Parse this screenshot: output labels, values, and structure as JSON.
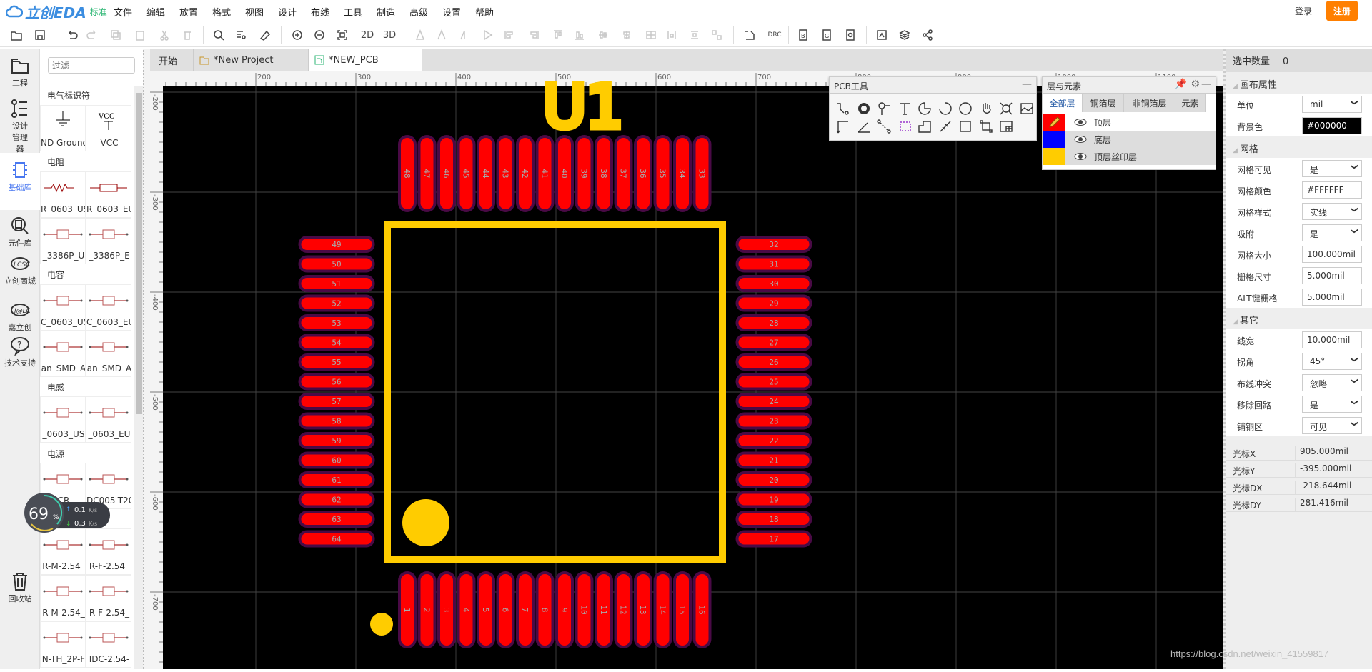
{
  "app": {
    "logo": "立创EDA",
    "edition": "标准",
    "login": "登录",
    "register": "注册"
  },
  "menu": [
    "文件",
    "编辑",
    "放置",
    "格式",
    "视图",
    "设计",
    "布线",
    "工具",
    "制造",
    "高级",
    "设置",
    "帮助"
  ],
  "toolbar": {
    "view2d": "2D",
    "view3d": "3D",
    "drc": "DRC"
  },
  "iconbar": [
    {
      "label": "工程",
      "icon": "folder-icon"
    },
    {
      "label": "设计管理器",
      "icon": "design-manager-icon"
    },
    {
      "label": "基础库",
      "icon": "chip-icon",
      "active": true
    },
    {
      "label": "元件库",
      "icon": "component-search-icon"
    },
    {
      "label": "立创商城",
      "icon": "lcsc-icon"
    },
    {
      "label": "嘉立创",
      "icon": "jlc-icon"
    },
    {
      "label": "技术支持",
      "icon": "help-bubble-icon"
    },
    {
      "label": "回收站",
      "icon": "trash-icon"
    }
  ],
  "library": {
    "filter_placeholder": "过滤",
    "categories": [
      {
        "name": "电气标识符",
        "items": [
          "ND Ground",
          "VCC"
        ]
      },
      {
        "name": "电阻",
        "items": [
          "R_0603_US",
          "R_0603_EU",
          "_3386P_U",
          "_3386P_E"
        ]
      },
      {
        "name": "电容",
        "items": [
          "C_0603_US",
          "C_0603_EU",
          "an_SMD_A",
          "an_SMD_A"
        ]
      },
      {
        "name": "电感",
        "items": [
          "_0603_US",
          "_0603_EU"
        ]
      },
      {
        "name": "电源",
        "items": [
          "CR",
          "DC005-T20"
        ]
      },
      {
        "name": "连接器",
        "items": [
          "R-M-2.54_",
          "R-F-2.54_",
          "R-M-2.54_",
          "R-F-2.54_",
          "N-TH_2P-F",
          "IDC-2.54-"
        ]
      }
    ]
  },
  "network": {
    "percent": "69",
    "unit": "%",
    "up": "0.1",
    "down": "0.3",
    "rate_unit": "K/s"
  },
  "tabs": [
    {
      "label": "开始"
    },
    {
      "label": "*New Project",
      "icon": "folder-icon"
    },
    {
      "label": "*NEW_PCB",
      "icon": "pcb-icon",
      "active": true
    }
  ],
  "rulers": {
    "top": [
      "200",
      "300",
      "400",
      "500",
      "600",
      "700",
      "800",
      "900",
      "1000",
      "1100"
    ],
    "left": [
      "-200",
      "-300",
      "-400",
      "-500",
      "-600",
      "-700"
    ]
  },
  "pcb": {
    "designator": "U1",
    "colors": {
      "pad": "#ff0000",
      "pad_mask": "#4a0a46",
      "silk": "#ffcc00",
      "background": "#000000"
    },
    "pads": {
      "top": [
        "48",
        "47",
        "46",
        "45",
        "44",
        "43",
        "42",
        "41",
        "40",
        "39",
        "38",
        "37",
        "36",
        "35",
        "34",
        "33"
      ],
      "left": [
        "49",
        "50",
        "51",
        "52",
        "53",
        "54",
        "55",
        "56",
        "57",
        "58",
        "59",
        "60",
        "61",
        "62",
        "63",
        "64"
      ],
      "right": [
        "32",
        "31",
        "30",
        "29",
        "28",
        "27",
        "26",
        "25",
        "24",
        "23",
        "22",
        "21",
        "20",
        "19",
        "18",
        "17"
      ],
      "bottom": [
        "1",
        "2",
        "3",
        "4",
        "5",
        "6",
        "7",
        "8",
        "9",
        "10",
        "11",
        "12",
        "13",
        "14",
        "15",
        "16"
      ]
    }
  },
  "pcb_tools": {
    "title": "PCB工具",
    "tools": [
      "track-icon",
      "pad-icon",
      "via-icon",
      "text-icon",
      "arc-icon",
      "arc-center-icon",
      "circle-icon",
      "pan-hand-icon",
      "hole-icon",
      "image-icon",
      "dimension-icon",
      "angle-icon",
      "connect-pad-icon",
      "copper-area-icon",
      "solid-region-icon",
      "measure-icon",
      "rectangle-icon",
      "group-icon",
      "table-icon"
    ]
  },
  "layers": {
    "title": "层与元素",
    "tabs": [
      "全部层",
      "铜箔层",
      "非铜箔层",
      "元素"
    ],
    "rows": [
      {
        "name": "顶层",
        "color": "#ff0000",
        "active": true
      },
      {
        "name": "底层",
        "color": "#0000ff"
      },
      {
        "name": "顶层丝印层",
        "color": "#ffcc00"
      }
    ]
  },
  "props": {
    "selected_label": "选中数量",
    "selected_value": "0",
    "sections": [
      {
        "title": "画布属性",
        "rows": [
          {
            "label": "单位",
            "value": "mil",
            "type": "select"
          },
          {
            "label": "背景色",
            "value": "#000000",
            "type": "color"
          }
        ]
      },
      {
        "title": "网格",
        "rows": [
          {
            "label": "网格可见",
            "value": "是",
            "type": "select"
          },
          {
            "label": "网格颜色",
            "value": "#FFFFFF",
            "type": "input"
          },
          {
            "label": "网格样式",
            "value": "实线",
            "type": "select"
          },
          {
            "label": "吸附",
            "value": "是",
            "type": "select"
          },
          {
            "label": "网格大小",
            "value": "100.000mil",
            "type": "input"
          },
          {
            "label": "栅格尺寸",
            "value": "5.000mil",
            "type": "input"
          },
          {
            "label": "ALT键栅格",
            "value": "5.000mil",
            "type": "input"
          }
        ]
      },
      {
        "title": "其它",
        "rows": [
          {
            "label": "线宽",
            "value": "10.000mil",
            "type": "input"
          },
          {
            "label": "拐角",
            "value": "45°",
            "type": "select"
          },
          {
            "label": "布线冲突",
            "value": "忽略",
            "type": "select"
          },
          {
            "label": "移除回路",
            "value": "是",
            "type": "select"
          },
          {
            "label": "铺铜区",
            "value": "可见",
            "type": "select"
          }
        ]
      }
    ],
    "cursor": [
      {
        "label": "光标X",
        "value": "905.000mil"
      },
      {
        "label": "光标Y",
        "value": "-395.000mil"
      },
      {
        "label": "光标DX",
        "value": "-218.644mil"
      },
      {
        "label": "光标DY",
        "value": "281.416mil"
      }
    ]
  },
  "watermark": "https://blog.csdn.net/weixin_41559817"
}
